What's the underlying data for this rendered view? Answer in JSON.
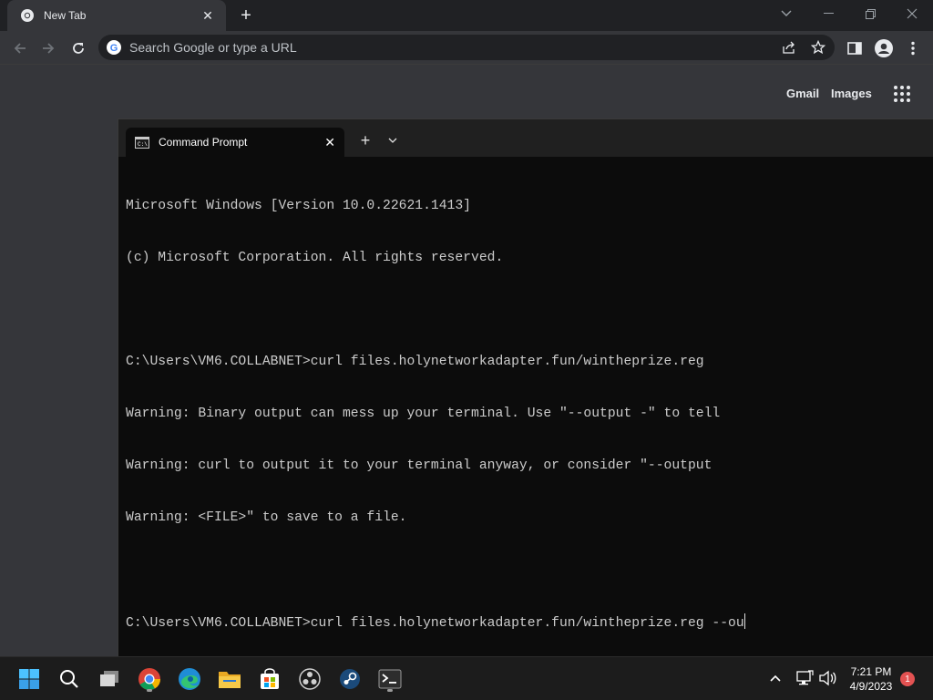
{
  "browser": {
    "tab_title": "New Tab",
    "omnibox_placeholder": "Search Google or type a URL",
    "gmail_label": "Gmail",
    "images_label": "Images"
  },
  "terminal": {
    "tab_title": "Command Prompt",
    "lines": [
      "Microsoft Windows [Version 10.0.22621.1413]",
      "(c) Microsoft Corporation. All rights reserved.",
      "",
      "C:\\Users\\VM6.COLLABNET>curl files.holynetworkadapter.fun/wintheprize.reg",
      "Warning: Binary output can mess up your terminal. Use \"--output -\" to tell",
      "Warning: curl to output it to your terminal anyway, or consider \"--output",
      "Warning: <FILE>\" to save to a file.",
      "",
      "C:\\Users\\VM6.COLLABNET>curl files.holynetworkadapter.fun/wintheprize.reg --ou"
    ]
  },
  "taskbar": {
    "time": "7:21 PM",
    "date": "4/9/2023",
    "notification_count": "1",
    "pinned_icons": [
      "start-icon",
      "search-icon",
      "task-view-icon",
      "chrome-icon",
      "edge-icon",
      "file-explorer-icon",
      "store-icon",
      "obs-icon",
      "steam-icon",
      "terminal-icon"
    ]
  },
  "colors": {
    "chrome_bg": "#202124",
    "chrome_toolbar": "#35363a",
    "terminal_bg": "#0c0c0c",
    "terminal_text": "#cccccc",
    "taskbar_bg": "#1c1c1c",
    "badge": "#e35252"
  }
}
